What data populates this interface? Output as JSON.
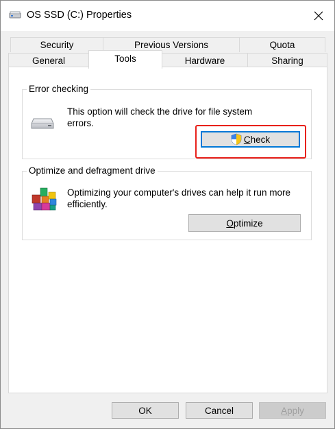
{
  "window": {
    "title": "OS SSD (C:) Properties"
  },
  "tabs": {
    "row1": [
      {
        "label": "Security"
      },
      {
        "label": "Previous Versions"
      },
      {
        "label": "Quota"
      }
    ],
    "row2": [
      {
        "label": "General"
      },
      {
        "label": "Tools",
        "active": true
      },
      {
        "label": "Hardware"
      },
      {
        "label": "Sharing"
      }
    ]
  },
  "error_checking": {
    "title": "Error checking",
    "line1": "This option will check the drive for file system",
    "line2": "errors.",
    "button_accel": "C",
    "button_rest": "heck"
  },
  "optimize": {
    "title": "Optimize and defragment drive",
    "line1": "Optimizing your computer's drives can help it run more",
    "line2": "efficiently.",
    "button_accel": "O",
    "button_rest": "ptimize"
  },
  "footer": {
    "ok": "OK",
    "cancel": "Cancel",
    "apply_accel": "A",
    "apply_rest": "pply"
  },
  "colors": {
    "highlight": "#e8201a",
    "focus": "#0078d7"
  }
}
